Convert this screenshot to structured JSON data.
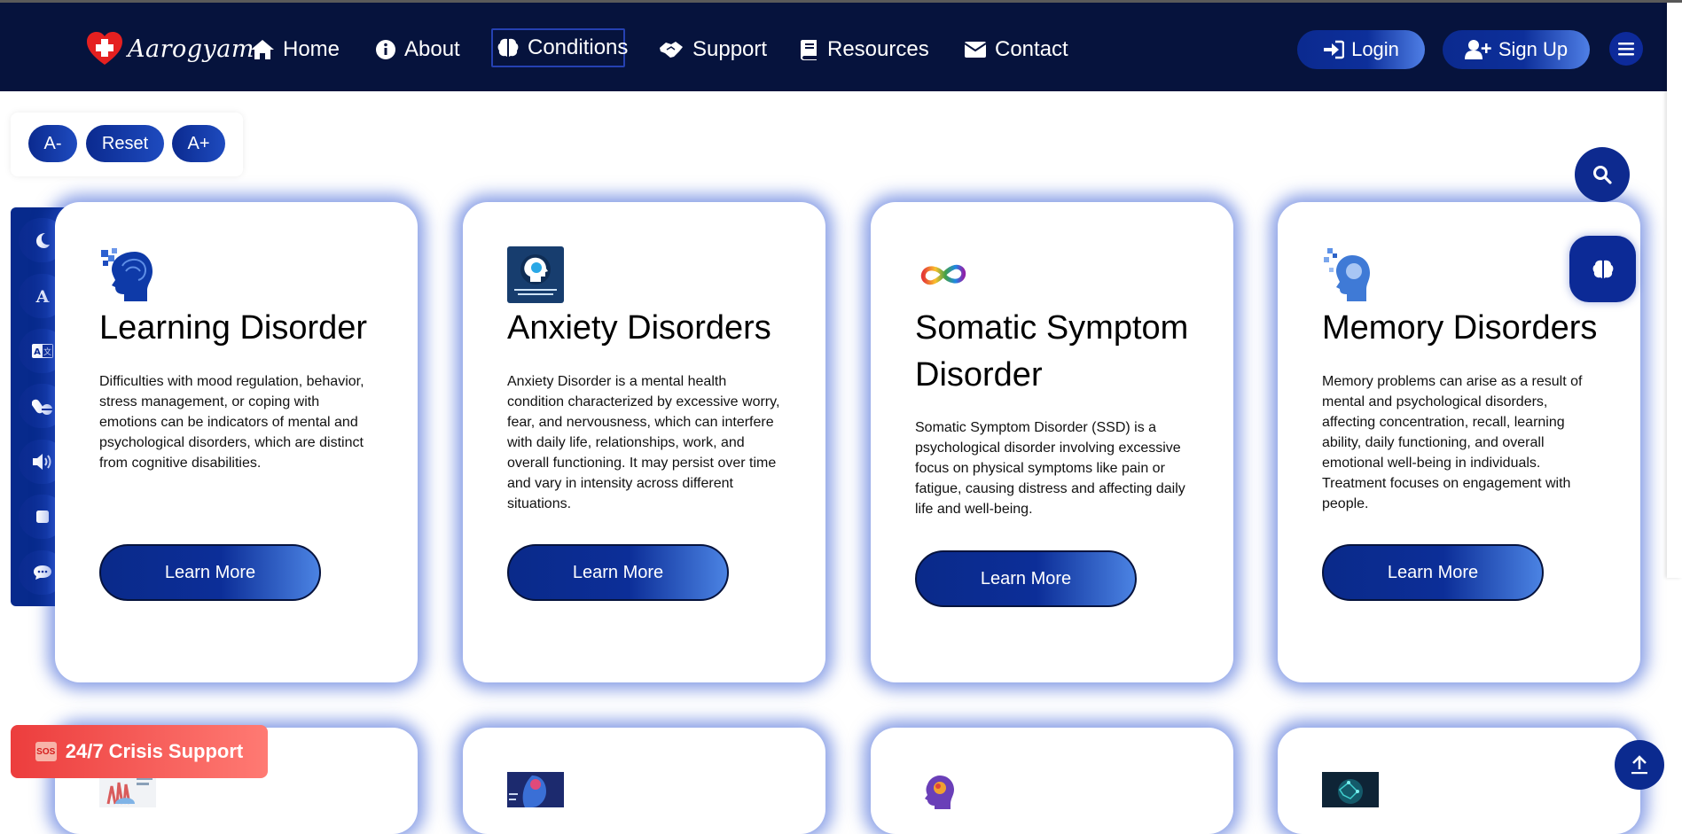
{
  "brand": {
    "name": "Aarogyam"
  },
  "nav": {
    "items": [
      {
        "label": "Home",
        "icon": "home-icon"
      },
      {
        "label": "About",
        "icon": "info-icon"
      },
      {
        "label": "Conditions",
        "icon": "brain-icon"
      },
      {
        "label": "Support",
        "icon": "handshake-icon"
      },
      {
        "label": "Resources",
        "icon": "book-icon"
      },
      {
        "label": "Contact",
        "icon": "envelope-icon"
      }
    ],
    "active": "Conditions"
  },
  "auth": {
    "login": "Login",
    "signup": "Sign Up"
  },
  "font_controls": {
    "decrease": "A-",
    "reset": "Reset",
    "increase": "A+"
  },
  "sidebar_tools": [
    "moon-icon",
    "font-icon",
    "translate-icon",
    "pills-icon",
    "volume-icon",
    "stop-icon",
    "chat-icon"
  ],
  "cards": [
    {
      "title": "Learning Disorder",
      "description": "Difficulties with mood regulation, behavior, stress management, or coping with emotions can be indicators of mental and psychological disorders, which are distinct from cognitive disabilities.",
      "button": "Learn More"
    },
    {
      "title": "Anxiety Disorders",
      "description": "Anxiety Disorder is a mental health condition characterized by excessive worry, fear, and nervousness, which can interfere with daily life, relationships, work, and overall functioning. It may persist over time and vary in intensity across different situations.",
      "button": "Learn More"
    },
    {
      "title": "Somatic Symptom Disorder",
      "description": "Somatic Symptom Disorder (SSD) is a psychological disorder involving excessive focus on physical symptoms like pain or fatigue, causing distress and affecting daily life and well-being.",
      "button": "Learn More"
    },
    {
      "title": "Memory Disorders",
      "description": "Memory problems can arise as a result of mental and psychological disorders, affecting concentration, recall, learning ability, daily functioning, and overall emotional well-being in individuals. Treatment focuses on engagement with people.",
      "button": "Learn More"
    }
  ],
  "crisis": {
    "badge": "SOS",
    "label": "24/7 Crisis Support"
  },
  "colors": {
    "navbar": "#06133d",
    "accent": "#0c2e98",
    "crisis": "#ec3d3d"
  }
}
